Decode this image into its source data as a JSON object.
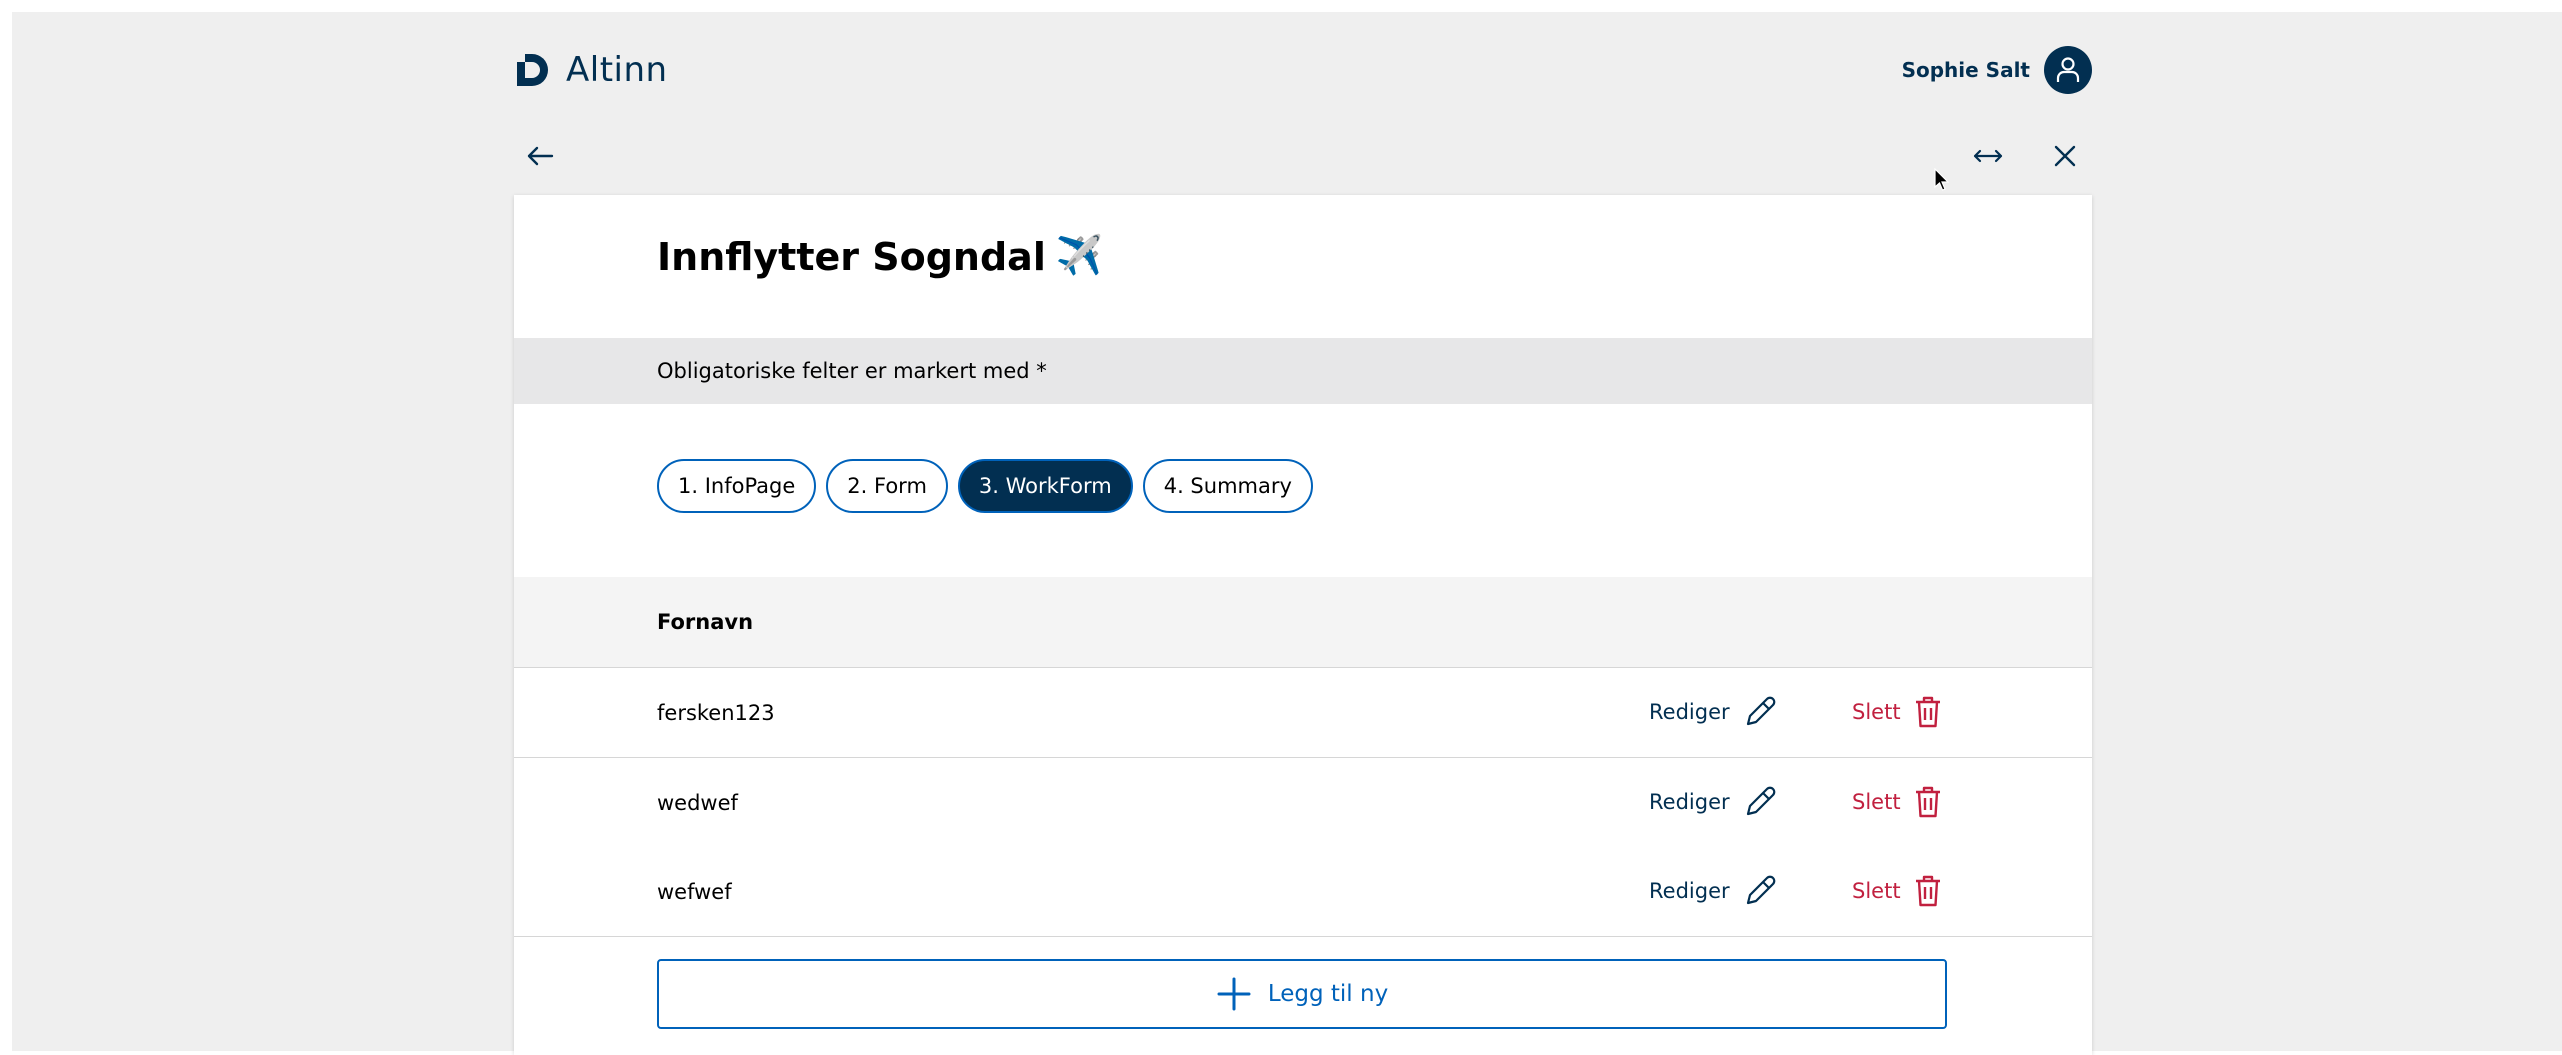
{
  "header": {
    "logo_text": "Altinn",
    "user_name": "Sophie Salt"
  },
  "form": {
    "title": "Innflytter Sogndal",
    "title_emoji": "✈️",
    "required_notice": "Obligatoriske felter er markert med *"
  },
  "navigation": {
    "pages": [
      {
        "label": "1. InfoPage",
        "active": false
      },
      {
        "label": "2. Form",
        "active": false
      },
      {
        "label": "3. WorkForm",
        "active": true
      },
      {
        "label": "4. Summary",
        "active": false
      }
    ]
  },
  "table": {
    "column_header": "Fornavn",
    "edit_label": "Rediger",
    "delete_label": "Slett",
    "rows": [
      {
        "fornavn": "fersken123"
      },
      {
        "fornavn": "wedwef"
      },
      {
        "fornavn": "wefwef"
      }
    ]
  },
  "add_button_label": "Legg til ny",
  "colors": {
    "navy": "#022f51",
    "blue": "#0062ba",
    "danger": "#c1203f",
    "page_bg": "#efefef",
    "banner_bg": "#e7e7e8"
  },
  "icons": {
    "back": "arrow-left-icon",
    "expand": "arrows-horizontal-icon",
    "close": "close-icon",
    "user": "person-icon",
    "edit": "pencil-icon",
    "delete": "trash-icon",
    "add": "plus-icon"
  }
}
